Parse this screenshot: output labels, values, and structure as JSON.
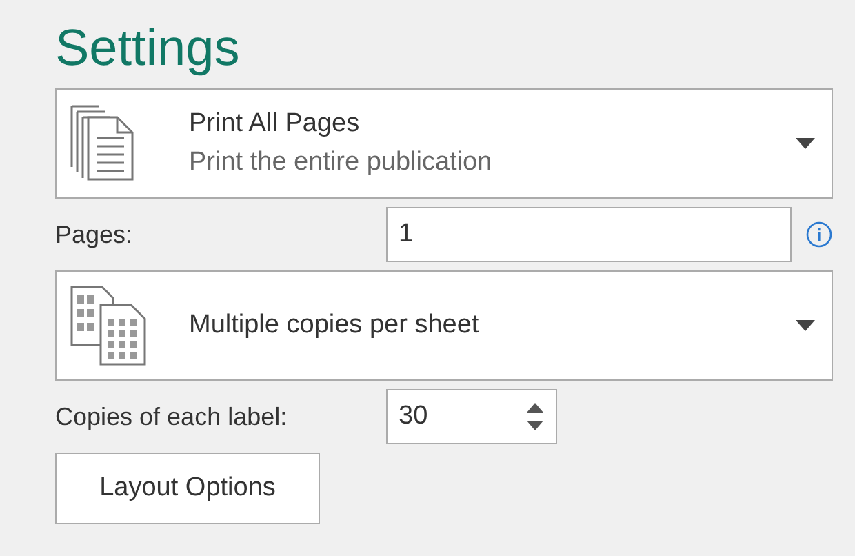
{
  "title": "Settings",
  "dropdowns": [
    {
      "kind": "pages",
      "label": "Print All Pages",
      "description": "Print the entire publication"
    },
    {
      "kind": "copies",
      "label": "Multiple copies per sheet"
    }
  ],
  "pages": {
    "label": "Pages:",
    "value": "1"
  },
  "copies": {
    "label": "Copies of each label:",
    "value": "30"
  },
  "button": "Layout Options"
}
